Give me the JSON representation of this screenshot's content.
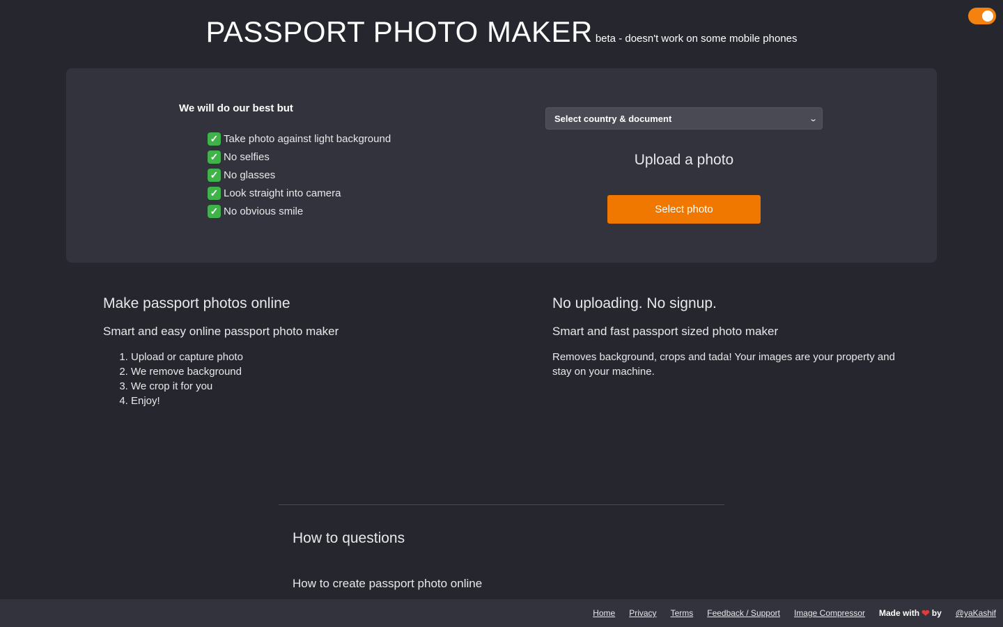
{
  "header": {
    "title": "PASSPORT PHOTO MAKER",
    "subtitle": "beta - doesn't work on some mobile phones"
  },
  "theme_toggle": {
    "state": "on",
    "accent": "#f5820f"
  },
  "tips": {
    "heading": "We will do our best but",
    "items": [
      "Take photo against light background",
      "No selfies",
      "No glasses",
      "Look straight into camera",
      "No obvious smile"
    ]
  },
  "uploader": {
    "select_placeholder": "Select country & document",
    "upload_label": "Upload a photo",
    "button_label": "Select photo",
    "button_color": "#f07800"
  },
  "info_left": {
    "heading": "Make passport photos online",
    "subheading": "Smart and easy online passport photo maker",
    "steps": [
      "Upload or capture photo",
      "We remove background",
      "We crop it for you",
      "Enjoy!"
    ]
  },
  "info_right": {
    "heading": "No uploading. No signup.",
    "subheading": "Smart and fast passport sized photo maker",
    "description": "Removes background, crops and tada! Your images are your property and stay on your machine."
  },
  "faq": {
    "heading": "How to questions",
    "items": [
      "How to create passport photo online"
    ]
  },
  "footer": {
    "links": [
      "Home",
      "Privacy",
      "Terms",
      "Feedback / Support",
      "Image Compressor"
    ],
    "made_with": "Made with",
    "by": "by",
    "author": "@yaKashif"
  }
}
